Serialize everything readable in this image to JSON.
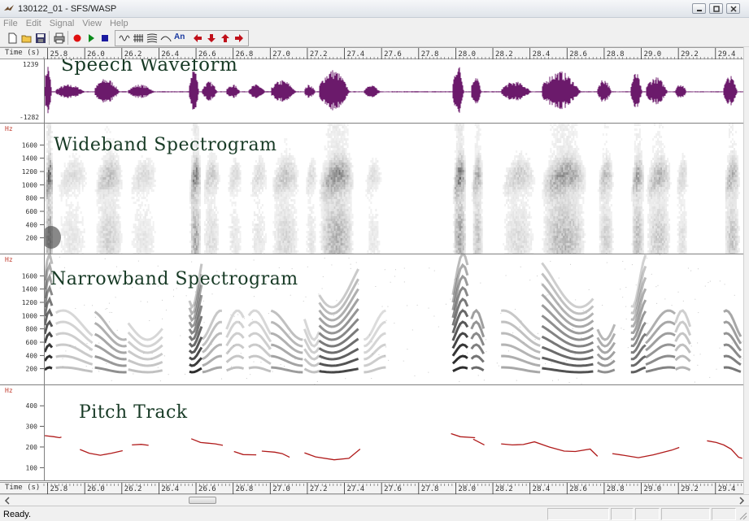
{
  "window": {
    "title": "130122_01 - SFS/WASP"
  },
  "menu": [
    "File",
    "Edit",
    "Signal",
    "View",
    "Help"
  ],
  "toolbar": {
    "buttons": [
      "new-file-icon",
      "open-folder-icon",
      "save-icon",
      "print-icon",
      "record-icon",
      "play-icon",
      "stop-icon",
      "waveform-view-icon",
      "wideband-view-icon",
      "narrowband-view-icon",
      "pitch-view-icon",
      "annotation-icon",
      "scroll-left-icon",
      "zoom-in-icon",
      "zoom-out-icon",
      "scroll-right-icon"
    ],
    "annotation_label": "An"
  },
  "time_axis": {
    "label": "Time (s)",
    "ticks": [
      "25.8",
      "26.0",
      "26.2",
      "26.4",
      "26.6",
      "26.8",
      "27.0",
      "27.2",
      "27.4",
      "27.6",
      "27.8",
      "28.0",
      "28.2",
      "28.4",
      "28.6",
      "28.8",
      "29.0",
      "29.2",
      "29.4"
    ],
    "start": 25.78,
    "end": 29.55
  },
  "panels": {
    "waveform": {
      "title": "Speech Waveform",
      "max_label": "1239",
      "min_label": "-1282",
      "color": "#6b1a6b"
    },
    "wideband": {
      "title": "Wideband Spectrogram",
      "unit": "Hz",
      "ticks": [
        "1600",
        "1400",
        "1200",
        "1000",
        "800",
        "600",
        "400",
        "200"
      ]
    },
    "narrowband": {
      "title": "Narrowband Spectrogram",
      "unit": "Hz",
      "ticks": [
        "1600",
        "1400",
        "1200",
        "1000",
        "800",
        "600",
        "400",
        "200"
      ]
    },
    "pitch": {
      "title": "Pitch Track",
      "unit": "Hz",
      "ticks": [
        "400",
        "300",
        "200",
        "100"
      ],
      "color": "#b01a1a"
    }
  },
  "status": {
    "text": "Ready."
  }
}
